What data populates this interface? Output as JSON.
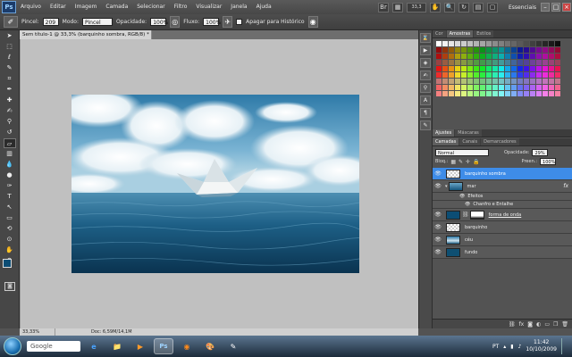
{
  "app": {
    "logo": "Ps",
    "menu": [
      "Arquivo",
      "Editar",
      "Imagem",
      "Camada",
      "Selecionar",
      "Filtro",
      "Visualizar",
      "Janela",
      "Ajuda"
    ],
    "zoom_display": "33,3",
    "workspace": "Essenciais"
  },
  "options": {
    "brush_label": "Pincel:",
    "brush_size": "209",
    "mode_label": "Modo:",
    "mode_value": "Pincel",
    "opacity_label": "Opacidade:",
    "opacity_value": "100%",
    "flow_label": "Fluxo:",
    "flow_value": "100%",
    "history_label": "Apagar para Histórico"
  },
  "document": {
    "tab_title": "Sem título-1 @ 33,3% (barquinho sombra, RGB/8) *",
    "status_zoom": "33,33%",
    "status_doc": "Doc: 6,59M/14,1M"
  },
  "swatches_panel": {
    "tabs": [
      "Cor",
      "Amostras",
      "Estilos"
    ],
    "active_tab": 1
  },
  "adjust_panel": {
    "tabs": [
      "Ajustes",
      "Máscaras"
    ]
  },
  "layers_panel": {
    "tabs": [
      "Camadas",
      "Canais",
      "Demarcadores"
    ],
    "blend_mode": "Normal",
    "opacity_label": "Opacidade:",
    "opacity_value": "29%",
    "lock_label": "Bloq.:",
    "fill_label": "Preen.:",
    "fill_value": "100%",
    "layers": [
      {
        "name": "barquinho sombra",
        "selected": true
      },
      {
        "name": "mar",
        "fx": "fx"
      },
      {
        "name": "forma de onda"
      },
      {
        "name": "barquinho"
      },
      {
        "name": "céu"
      },
      {
        "name": "fundo"
      }
    ],
    "effects_label": "Efeitos",
    "effect_item": "Chanfro e Entalhe"
  },
  "taskbar": {
    "search_text": "Google",
    "language": "PT",
    "time": "11:42",
    "date": "10/10/2009"
  },
  "colors": {
    "foreground": "#0c4d74",
    "background": "#ffffff",
    "selected_layer": "#3e8ce8"
  }
}
